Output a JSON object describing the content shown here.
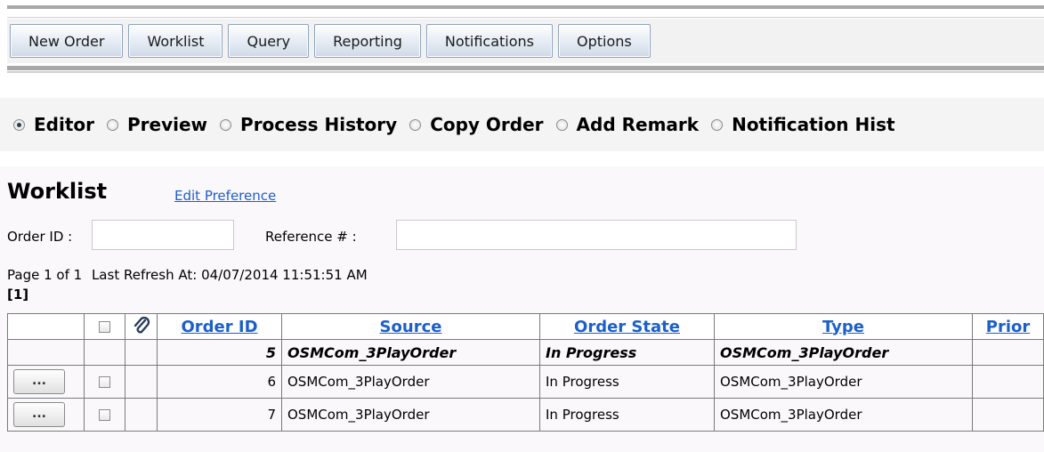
{
  "toolbar": {
    "buttons": [
      "New Order",
      "Worklist",
      "Query",
      "Reporting",
      "Notifications",
      "Options"
    ]
  },
  "modes": {
    "selected": "Editor",
    "options": [
      "Editor",
      "Preview",
      "Process History",
      "Copy Order",
      "Add Remark",
      "Notification Hist"
    ]
  },
  "worklist": {
    "title": "Worklist",
    "edit_preference": "Edit Preference",
    "order_id_label": "Order ID :",
    "order_id_value": "",
    "reference_label": "Reference # :",
    "reference_value": "",
    "page_info": "Page 1 of 1",
    "last_refresh": "Last Refresh At: 04/07/2014 11:51:51 AM",
    "page_links": "[1]"
  },
  "table": {
    "headers": [
      "Order ID",
      "Source",
      "Order State",
      "Type",
      "Prior"
    ],
    "rows": [
      {
        "order_id": "5",
        "source": "OSMCom_3PlayOrder",
        "state": "In Progress",
        "type": "OSMCom_3PlayOrder",
        "bold": true
      },
      {
        "order_id": "6",
        "source": "OSMCom_3PlayOrder",
        "state": "In Progress",
        "type": "OSMCom_3PlayOrder",
        "action": "..."
      },
      {
        "order_id": "7",
        "source": "OSMCom_3PlayOrder",
        "state": "In Progress",
        "type": "OSMCom_3PlayOrder",
        "action": "..."
      }
    ]
  },
  "icons": {
    "attachment": "paperclip-icon",
    "select_all": "checkbox-icon"
  }
}
